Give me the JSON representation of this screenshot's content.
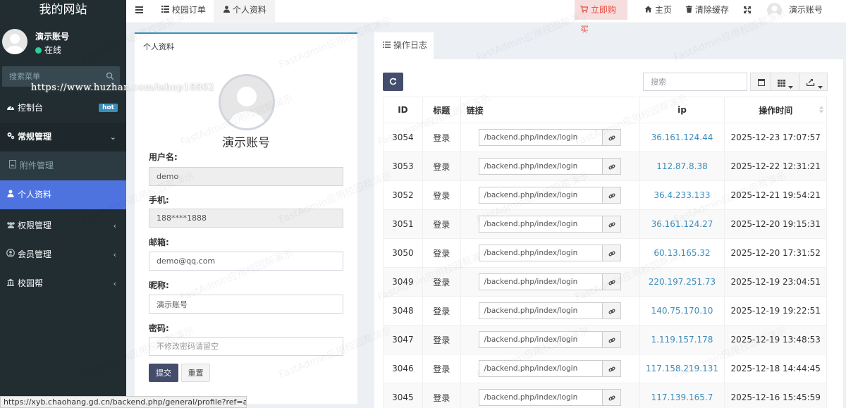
{
  "sidebar": {
    "brand": "我的网站",
    "user_name": "演示账号",
    "user_status": "在线",
    "search_placeholder": "搜索菜单",
    "items": [
      {
        "label": "控制台",
        "badge": "hot"
      },
      {
        "label": "常规管理"
      },
      {
        "label": "附件管理"
      },
      {
        "label": "个人资料"
      },
      {
        "label": "权限管理"
      },
      {
        "label": "会员管理"
      },
      {
        "label": "校园帮"
      }
    ]
  },
  "topbar": {
    "tabs": [
      {
        "label": "校园订单"
      },
      {
        "label": "个人资料"
      }
    ],
    "buy_label": "立即购买",
    "home_label": "主页",
    "clear_cache_label": "清除缓存",
    "account_label": "演示账号"
  },
  "profile": {
    "panel_title": "个人资料",
    "display_name": "演示账号",
    "username_label": "用户名:",
    "username_value": "demo",
    "phone_label": "手机:",
    "phone_value": "188****1888",
    "email_label": "邮箱:",
    "email_value": "demo@qq.com",
    "nickname_label": "昵称:",
    "nickname_value": "演示账号",
    "password_label": "密码:",
    "password_placeholder": "不修改密码请留空",
    "submit_label": "提交",
    "reset_label": "重置"
  },
  "log": {
    "tab_label": "操作日志",
    "search_placeholder": "搜索",
    "columns": [
      "ID",
      "标题",
      "链接",
      "ip",
      "操作时间"
    ],
    "rows": [
      {
        "id": "3054",
        "title": "登录",
        "url": "/backend.php/index/login",
        "ip": "36.161.124.44",
        "time": "2025-12-23 17:07:57"
      },
      {
        "id": "3053",
        "title": "登录",
        "url": "/backend.php/index/login",
        "ip": "112.87.8.38",
        "time": "2025-12-22 12:31:21"
      },
      {
        "id": "3052",
        "title": "登录",
        "url": "/backend.php/index/login",
        "ip": "36.4.233.133",
        "time": "2025-12-21 19:54:21"
      },
      {
        "id": "3051",
        "title": "登录",
        "url": "/backend.php/index/login",
        "ip": "36.161.124.27",
        "time": "2025-12-20 19:15:31"
      },
      {
        "id": "3050",
        "title": "登录",
        "url": "/backend.php/index/login",
        "ip": "60.13.165.32",
        "time": "2025-12-20 17:31:52"
      },
      {
        "id": "3049",
        "title": "登录",
        "url": "/backend.php/index/login",
        "ip": "220.197.251.73",
        "time": "2025-12-19 23:04:51"
      },
      {
        "id": "3048",
        "title": "登录",
        "url": "/backend.php/index/login",
        "ip": "140.75.170.10",
        "time": "2025-12-19 19:22:51"
      },
      {
        "id": "3047",
        "title": "登录",
        "url": "/backend.php/index/login",
        "ip": "1.119.157.178",
        "time": "2025-12-19 13:48:53"
      },
      {
        "id": "3046",
        "title": "登录",
        "url": "/backend.php/index/login",
        "ip": "117.158.219.131",
        "time": "2025-12-18 14:44:45"
      },
      {
        "id": "3045",
        "title": "登录",
        "url": "/backend.php/index/login",
        "ip": "117.139.165.7",
        "time": "2025-12-16 15:45:59"
      }
    ]
  },
  "overlay": {
    "watermark_url": "https://www.huzhan.com/ishop18862",
    "status_url": "https://xyb.chaohang.gd.cn/backend.php/general/profile?ref=addtabs",
    "watermark_text": "FastAdmin应用校园帮演示"
  },
  "colors": {
    "sidebar_bg": "#222d32",
    "active_menu": "#4e73df",
    "primary_btn": "#444d6b",
    "link": "#3c8dbc",
    "buy_text": "#e74c3c"
  }
}
